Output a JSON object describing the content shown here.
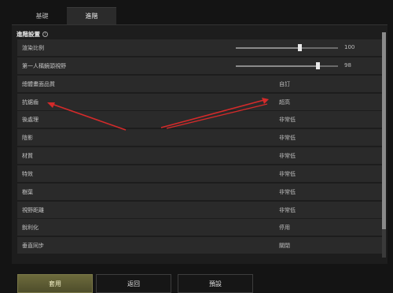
{
  "tabs": [
    {
      "label": "基礎",
      "active": false
    },
    {
      "label": "進階",
      "active": true
    }
  ],
  "section": {
    "title": "進階設置",
    "info_icon": "info-icon"
  },
  "rows": [
    {
      "label": "渲染比例",
      "type": "slider",
      "value": "100",
      "fraction": 0.62
    },
    {
      "label": "第一人稱鏡頭視野",
      "type": "slider",
      "value": "98",
      "fraction": 0.8
    },
    {
      "label": "總體畫面品質",
      "type": "value",
      "value": "自訂"
    },
    {
      "label": "抗鋸齒",
      "type": "value",
      "value": "超高"
    },
    {
      "label": "後處理",
      "type": "value",
      "value": "非常低"
    },
    {
      "label": "陰影",
      "type": "value",
      "value": "非常低"
    },
    {
      "label": "材質",
      "type": "value",
      "value": "非常低"
    },
    {
      "label": "特效",
      "type": "value",
      "value": "非常低"
    },
    {
      "label": "樹葉",
      "type": "value",
      "value": "非常低"
    },
    {
      "label": "視野距離",
      "type": "value",
      "value": "非常低"
    },
    {
      "label": "銳利化",
      "type": "value",
      "value": "停用"
    },
    {
      "label": "垂直同步",
      "type": "value",
      "value": "關閉"
    }
  ],
  "buttons": {
    "apply": "套用",
    "back": "返回",
    "default": "預設"
  },
  "colors": {
    "annotation": "#d42a2a",
    "apply_bg": "#5e5c33"
  }
}
